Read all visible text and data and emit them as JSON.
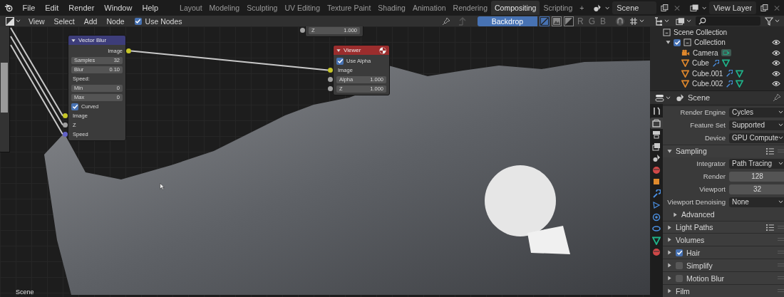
{
  "top_bar": {
    "menus": [
      "File",
      "Edit",
      "Render",
      "Window",
      "Help"
    ],
    "workspaces": [
      {
        "label": "Layout",
        "selected": false
      },
      {
        "label": "Modeling",
        "selected": false
      },
      {
        "label": "Sculpting",
        "selected": false
      },
      {
        "label": "UV Editing",
        "selected": false
      },
      {
        "label": "Texture Paint",
        "selected": false
      },
      {
        "label": "Shading",
        "selected": false
      },
      {
        "label": "Animation",
        "selected": false
      },
      {
        "label": "Rendering",
        "selected": false
      },
      {
        "label": "Compositing",
        "selected": true
      },
      {
        "label": "Scripting",
        "selected": false
      }
    ],
    "add_workspace": "+",
    "scene": "Scene",
    "view_layer": "View Layer"
  },
  "editor_header": {
    "menus": [
      "View",
      "Select",
      "Add",
      "Node"
    ],
    "use_nodes": {
      "label": "Use Nodes",
      "checked": true
    },
    "backdrop": {
      "label": "Backdrop",
      "selected": true
    },
    "backdrop_modes": [
      {
        "selected": true
      },
      {
        "selected": false
      },
      {
        "selected": false
      }
    ],
    "channels": [
      {
        "label": "R",
        "selected": false
      },
      {
        "label": "G",
        "selected": false
      },
      {
        "label": "B",
        "selected": false
      }
    ]
  },
  "nodes": [
    {
      "kind": "cropped",
      "rows": [
        {
          "kind": "field",
          "label": "Z",
          "value": "1.000",
          "color": "#a1a1a1"
        }
      ]
    },
    {
      "kind": "full",
      "title": "Vector Blur",
      "color": "#3d3d7a",
      "rows": [
        {
          "kind": "output",
          "label": "Image",
          "color": "#c7c729"
        },
        {
          "kind": "field",
          "label": "Samples",
          "value": "32"
        },
        {
          "kind": "field",
          "label": "Blur",
          "value": "0.10"
        },
        {
          "kind": "label",
          "label": "Speed:"
        },
        {
          "kind": "field",
          "label": "Min",
          "value": "0"
        },
        {
          "kind": "field",
          "label": "Max",
          "value": "0"
        },
        {
          "kind": "checkbox",
          "label": "Curved",
          "checked": true
        },
        {
          "kind": "input",
          "label": "Image",
          "color": "#c7c729"
        },
        {
          "kind": "input",
          "label": "Z",
          "color": "#a1a1a1"
        },
        {
          "kind": "input",
          "label": "Speed",
          "color": "#6363c7"
        }
      ]
    },
    {
      "kind": "full",
      "title": "Viewer",
      "color": "#9b2d2d",
      "rows": [
        {
          "kind": "checkbox",
          "label": "Use Alpha",
          "checked": true
        },
        {
          "kind": "input",
          "label": "Image",
          "color": "#c7c729"
        },
        {
          "kind": "field",
          "label": "Alpha",
          "value": "1.000",
          "color": "#a1a1a1"
        },
        {
          "kind": "field",
          "label": "Z",
          "value": "1.000",
          "color": "#a1a1a1"
        }
      ]
    }
  ],
  "canvas_label": "Scene",
  "outliner": {
    "root": "Scene Collection",
    "items": [
      {
        "label": "Collection",
        "checked": true,
        "expanded": true,
        "visible": true,
        "children": [
          {
            "label": "Camera",
            "kind": "camera",
            "visible": true
          },
          {
            "label": "Cube",
            "kind": "mesh",
            "visible": true
          },
          {
            "label": "Cube.001",
            "kind": "mesh",
            "visible": true
          },
          {
            "label": "Cube.002",
            "kind": "mesh",
            "visible": true
          }
        ]
      }
    ]
  },
  "properties": {
    "context": "Scene",
    "tabs": [
      {
        "kind": "tool",
        "selected": false
      },
      {
        "kind": "render",
        "selected": true
      },
      {
        "kind": "output",
        "selected": false
      },
      {
        "kind": "view_layer",
        "selected": false
      },
      {
        "kind": "scene",
        "selected": false
      },
      {
        "kind": "world",
        "selected": false
      },
      {
        "kind": "object",
        "selected": false
      },
      {
        "kind": "modifier",
        "selected": false
      },
      {
        "kind": "particles",
        "selected": false
      },
      {
        "kind": "physics",
        "selected": false
      },
      {
        "kind": "constraints",
        "selected": false
      },
      {
        "kind": "data",
        "selected": false
      },
      {
        "kind": "material",
        "selected": false
      }
    ],
    "rows": [
      {
        "kind": "dropdown",
        "label": "Render Engine",
        "value": "Cycles"
      },
      {
        "kind": "dropdown",
        "label": "Feature Set",
        "value": "Supported"
      },
      {
        "kind": "dropdown",
        "label": "Device",
        "value": "GPU Compute"
      },
      {
        "kind": "panel",
        "label": "Sampling",
        "expanded": true,
        "presets": true,
        "children": [
          {
            "kind": "dropdown",
            "label": "Integrator",
            "value": "Path Tracing"
          },
          {
            "kind": "number",
            "label": "Render",
            "value": "128"
          },
          {
            "kind": "number",
            "label": "Viewport",
            "value": "32"
          },
          {
            "kind": "dropdown",
            "label": "Viewport Denoising",
            "value": "None"
          },
          {
            "kind": "panel",
            "label": "Advanced",
            "expanded": false,
            "presets": false
          }
        ]
      },
      {
        "kind": "panel",
        "label": "Light Paths",
        "expanded": false,
        "presets": true
      },
      {
        "kind": "panel",
        "label": "Volumes",
        "expanded": false,
        "presets": false
      },
      {
        "kind": "panel",
        "label": "Hair",
        "expanded": false,
        "presets": false,
        "checked": true
      },
      {
        "kind": "panel",
        "label": "Simplify",
        "expanded": false,
        "presets": false,
        "checked": false
      },
      {
        "kind": "panel",
        "label": "Motion Blur",
        "expanded": false,
        "presets": false,
        "checked": false
      },
      {
        "kind": "panel",
        "label": "Film",
        "expanded": false,
        "presets": false
      }
    ]
  }
}
